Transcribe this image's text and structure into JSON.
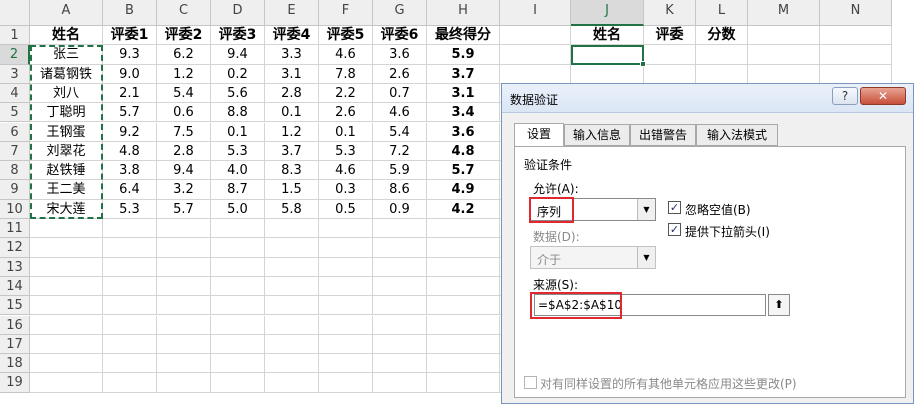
{
  "spreadsheet": {
    "columns": [
      "A",
      "B",
      "C",
      "D",
      "E",
      "F",
      "G",
      "H",
      "I",
      "J",
      "K",
      "L",
      "M",
      "N"
    ],
    "rows": [
      "1",
      "2",
      "3",
      "4",
      "5",
      "6",
      "7",
      "8",
      "9",
      "10",
      "11",
      "12",
      "13",
      "14",
      "15",
      "16",
      "17",
      "18",
      "19"
    ],
    "headers": [
      "姓名",
      "评委1",
      "评委2",
      "评委3",
      "评委4",
      "评委5",
      "评委6",
      "最终得分"
    ],
    "data": [
      [
        "张三",
        "9.3",
        "6.2",
        "9.4",
        "3.3",
        "4.6",
        "3.6",
        "5.9"
      ],
      [
        "诸葛钢铁",
        "9.0",
        "1.2",
        "0.2",
        "3.1",
        "7.8",
        "2.6",
        "3.7"
      ],
      [
        "刘八",
        "2.1",
        "5.4",
        "5.6",
        "2.8",
        "2.2",
        "0.7",
        "3.1"
      ],
      [
        "丁聪明",
        "5.7",
        "0.6",
        "8.8",
        "0.1",
        "2.6",
        "4.6",
        "3.4"
      ],
      [
        "王钢蛋",
        "9.2",
        "7.5",
        "0.1",
        "1.2",
        "0.1",
        "5.4",
        "3.6"
      ],
      [
        "刘翠花",
        "4.8",
        "2.8",
        "5.3",
        "3.7",
        "5.3",
        "7.2",
        "4.8"
      ],
      [
        "赵铁锤",
        "3.8",
        "9.4",
        "4.0",
        "8.3",
        "4.6",
        "5.9",
        "5.7"
      ],
      [
        "王二美",
        "6.4",
        "3.2",
        "8.7",
        "1.5",
        "0.3",
        "8.6",
        "4.9"
      ],
      [
        "宋大莲",
        "5.3",
        "5.7",
        "5.0",
        "5.8",
        "0.5",
        "0.9",
        "4.2"
      ]
    ],
    "lookup_headers": [
      "姓名",
      "评委",
      "分数"
    ]
  },
  "dialog": {
    "title": "数据验证",
    "help": "?",
    "close": "✕",
    "tabs": [
      "设置",
      "输入信息",
      "出错警告",
      "输入法模式"
    ],
    "criteria_label": "验证条件",
    "allow_label": "允许(A):",
    "allow_value": "序列",
    "data_label": "数据(D):",
    "data_value": "介于",
    "ignore_blank_label": "忽略空值(B)",
    "dropdown_label": "提供下拉箭头(I)",
    "source_label": "来源(S):",
    "source_value": "=$A$2:$A$10",
    "apply_all_label": "对有同样设置的所有其他单元格应用这些更改(P)",
    "check_mark": "✓",
    "ref_icon": "⬆",
    "dropdown_arrow": "▼"
  }
}
